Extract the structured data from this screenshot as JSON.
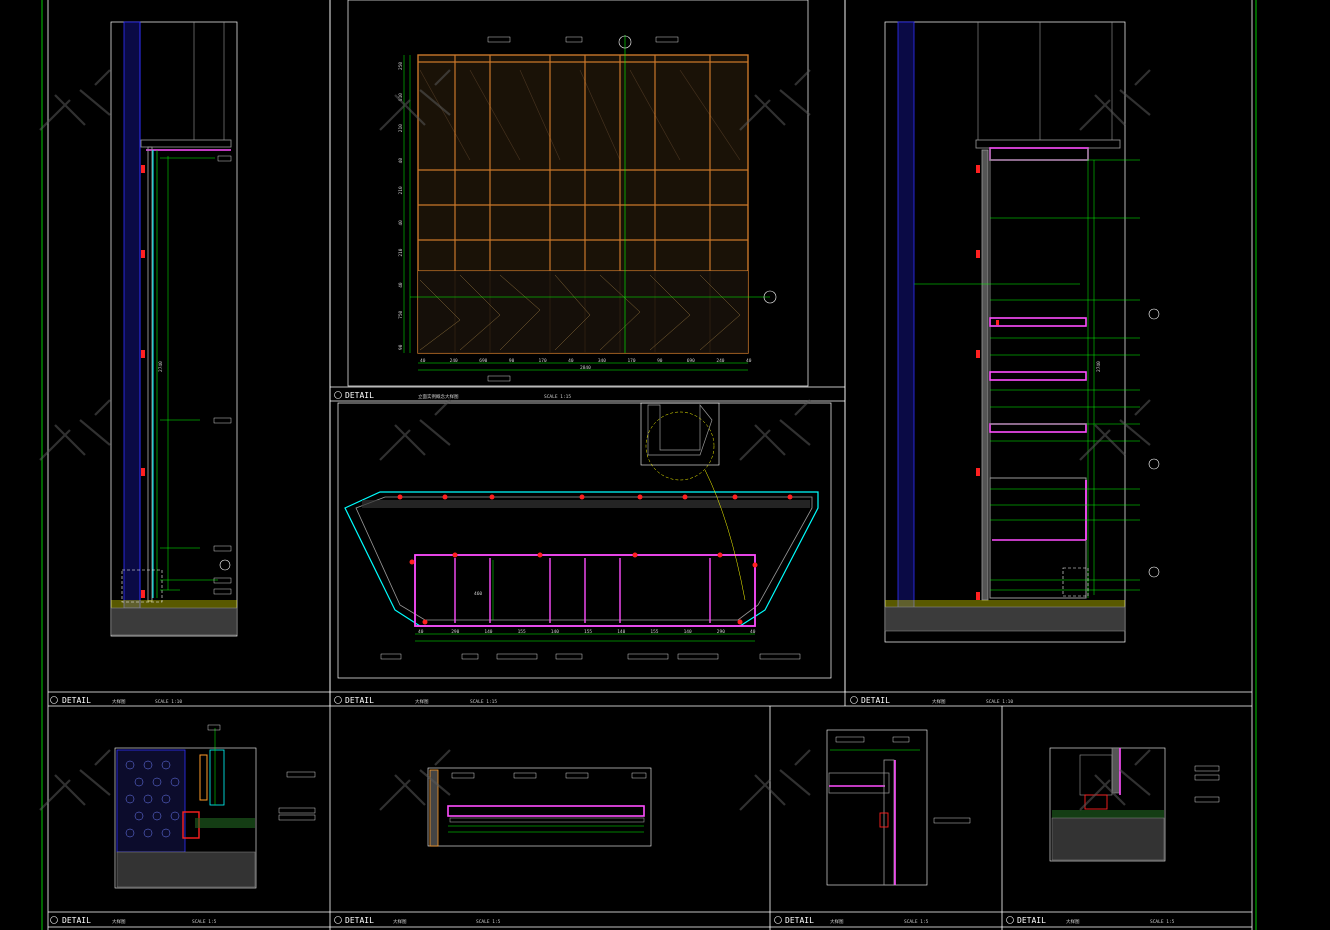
{
  "title_bars": [
    {
      "detail": "DETAIL",
      "name": "立面实例概念大样图",
      "scale": "SCALE  1:15"
    },
    {
      "detail": "DETAIL",
      "name": "大样图",
      "scale": "SCALE  1:10"
    },
    {
      "detail": "DETAIL",
      "name": "大样图",
      "scale": "SCALE  1:15"
    },
    {
      "detail": "DETAIL",
      "name": "大样图",
      "scale": "SCALE  1:10"
    },
    {
      "detail": "DETAIL",
      "name": "大样图",
      "scale": "SCALE  1:5"
    },
    {
      "detail": "DETAIL",
      "name": "大样图",
      "scale": "SCALE  1:5"
    },
    {
      "detail": "DETAIL",
      "name": "大样图",
      "scale": "SCALE  1:5"
    },
    {
      "detail": "DETAIL",
      "name": "大样图",
      "scale": "SCALE  1:5"
    }
  ],
  "elevation": {
    "overall_width": "2840",
    "top_dims": [
      "40",
      "240",
      "690",
      "90",
      "170",
      "40",
      "340",
      "170",
      "90",
      "690",
      "240",
      "40"
    ],
    "left_dims": [
      "250",
      "810",
      "210",
      "40",
      "210",
      "40",
      "210",
      "40",
      "750",
      "90"
    ]
  },
  "plan": {
    "dims": [
      "40",
      "290",
      "140",
      "155",
      "140",
      "155",
      "140",
      "155",
      "140",
      "290",
      "40"
    ],
    "depth": "460"
  },
  "section_right": {
    "height": "2740"
  },
  "section_left": {
    "height": "2740"
  },
  "colors": {
    "border": "#ffffff",
    "frame_green": "#00ff00",
    "wood": "#c9772a",
    "magenta": "#ff4dff",
    "red": "#ff2020",
    "blue": "#3030ff",
    "cyan": "#00ffff",
    "yellow": "#ffff00",
    "grey": "#9a9a9a"
  }
}
